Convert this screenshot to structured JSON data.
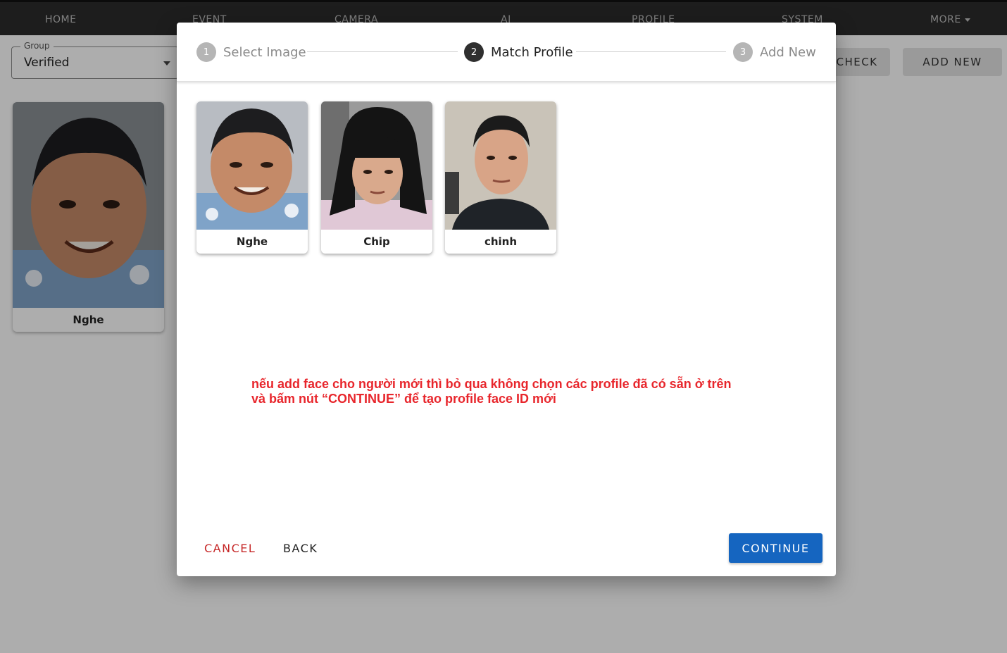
{
  "nav": {
    "items": [
      "HOME",
      "EVENT",
      "CAMERA",
      "AI",
      "PROFILE",
      "SYSTEM"
    ],
    "more_label": "MORE"
  },
  "filter": {
    "group_label": "Group",
    "group_value": "Verified"
  },
  "actions": {
    "check_label": "CHECK",
    "add_new_label": "ADD NEW"
  },
  "background_profile": {
    "name": "Nghe"
  },
  "dialog": {
    "steps": [
      {
        "number": "1",
        "label": "Select Image",
        "state": "inactive"
      },
      {
        "number": "2",
        "label": "Match Profile",
        "state": "active"
      },
      {
        "number": "3",
        "label": "Add New",
        "state": "inactive"
      }
    ],
    "profiles": [
      {
        "name": "Nghe"
      },
      {
        "name": "Chip"
      },
      {
        "name": "chinh"
      }
    ],
    "note_line1": "nếu add face cho người mới thì bỏ qua không chọn các profile đã có sẵn ở trên",
    "note_line2": "và bấm nút “CONTINUE” để tạo profile face ID mới",
    "cancel_label": "CANCEL",
    "back_label": "BACK",
    "continue_label": "CONTINUE"
  },
  "colors": {
    "primary": "#1565c0",
    "danger": "#c62828",
    "note": "#e8262c",
    "nav_bg": "#2b2b2b"
  }
}
